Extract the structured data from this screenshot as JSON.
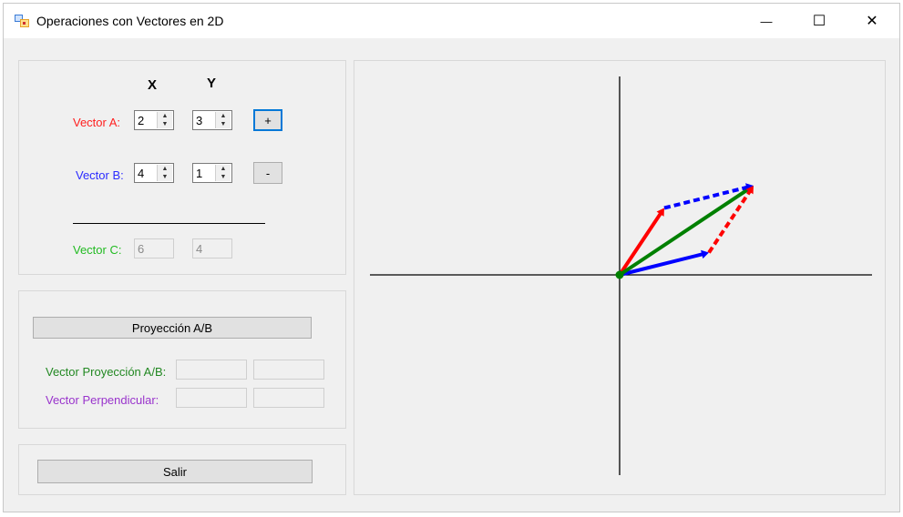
{
  "window": {
    "title": "Operaciones con Vectores en 2D",
    "controls": {
      "minimize": "—",
      "maximize": "☐",
      "close": "✕"
    }
  },
  "inputs": {
    "header_x": "X",
    "header_y": "Y",
    "vector_a": {
      "label": "Vector A:",
      "x": "2",
      "y": "3",
      "color": "#ff2020"
    },
    "vector_b": {
      "label": "Vector B:",
      "x": "4",
      "y": "1",
      "color": "#2b2bff"
    },
    "vector_c": {
      "label": "Vector C:",
      "x": "6",
      "y": "4",
      "color": "#22bb22"
    },
    "add_button": "+",
    "subtract_button": "-"
  },
  "projection": {
    "button": "Proyección A/B",
    "projection_label": "Vector Proyección A/B:",
    "projection_color": "#228822",
    "perpendicular_label": "Vector Perpendicular:",
    "perpendicular_color": "#9933cc",
    "projection_x": "",
    "projection_y": "",
    "perpendicular_x": "",
    "perpendicular_y": ""
  },
  "exit_button": "Salir",
  "plot": {
    "vectors": [
      {
        "name": "A",
        "from": [
          0,
          0
        ],
        "to": [
          2,
          3
        ],
        "color": "#ff0000",
        "style": "solid"
      },
      {
        "name": "B",
        "from": [
          0,
          0
        ],
        "to": [
          4,
          1
        ],
        "color": "#0000ff",
        "style": "solid"
      },
      {
        "name": "C",
        "from": [
          0,
          0
        ],
        "to": [
          6,
          4
        ],
        "color": "#008000",
        "style": "solid"
      },
      {
        "name": "B shifted",
        "from": [
          2,
          3
        ],
        "to": [
          6,
          4
        ],
        "color": "#0000ff",
        "style": "dashed"
      },
      {
        "name": "A shifted",
        "from": [
          4,
          1
        ],
        "to": [
          6,
          4
        ],
        "color": "#ff0000",
        "style": "dashed"
      }
    ],
    "axis_color": "#000000"
  }
}
